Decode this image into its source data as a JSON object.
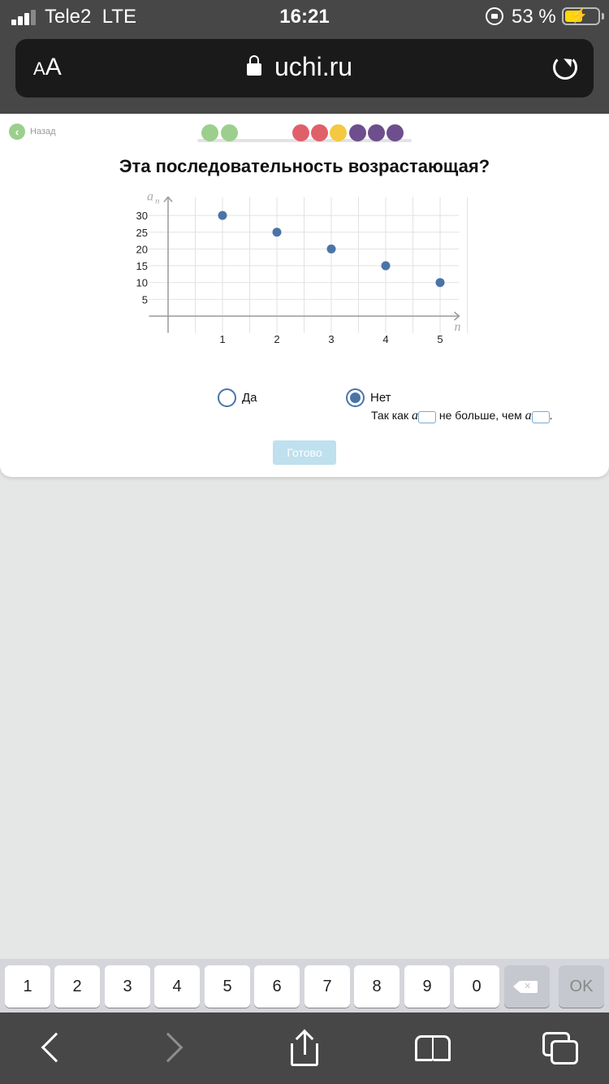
{
  "status_bar": {
    "carrier": "Tele2",
    "network": "LTE",
    "time": "16:21",
    "battery_percent": "53 %",
    "battery_level": 0.53,
    "battery_color": "#ffd60a",
    "icons": [
      "signal-icon",
      "orientation-lock-icon",
      "battery-charging-icon"
    ]
  },
  "browser": {
    "text_size_label_small": "A",
    "text_size_label_large": "A",
    "url": "uchi.ru",
    "icons": [
      "lock-icon",
      "reload-icon"
    ]
  },
  "task": {
    "back_label": "Назад",
    "progress_dot_colors": [
      "#9ccf8d",
      "#9ccf8d",
      "#e0606a",
      "#e0606a",
      "#f5c842",
      "#6e4e8c",
      "#6e4e8c",
      "#6e4e8c"
    ],
    "title": "Эта последовательность возрастающая?",
    "answers": [
      {
        "label": "Да",
        "selected": false
      },
      {
        "label": "Нет",
        "selected": true
      }
    ],
    "explanation": {
      "prefix": "Так как",
      "var1": "a",
      "middle": "не больше, чем",
      "var2": "a",
      "suffix": "."
    },
    "submit_label": "Готово",
    "accent_color": "#4a74a8"
  },
  "chart_data": {
    "type": "scatter",
    "x": [
      1,
      2,
      3,
      4,
      5
    ],
    "y": [
      30,
      25,
      20,
      15,
      10
    ],
    "xlabel": "n",
    "ylabel": "a",
    "ylabel_sub": "n",
    "x_ticks": [
      "1",
      "2",
      "3",
      "4",
      "5"
    ],
    "y_ticks": [
      "5",
      "10",
      "15",
      "20",
      "25",
      "30"
    ],
    "xlim": [
      0,
      5.5
    ],
    "ylim": [
      -5,
      35
    ],
    "grid": true,
    "point_color": "#4a74a8"
  },
  "keyboard": {
    "keys": [
      "1",
      "2",
      "3",
      "4",
      "5",
      "6",
      "7",
      "8",
      "9",
      "0"
    ],
    "ok_label": "OK",
    "icons": [
      "backspace-icon"
    ]
  },
  "toolbar": {
    "icons": [
      "back-icon",
      "forward-icon",
      "share-icon",
      "bookmarks-icon",
      "tabs-icon"
    ]
  }
}
